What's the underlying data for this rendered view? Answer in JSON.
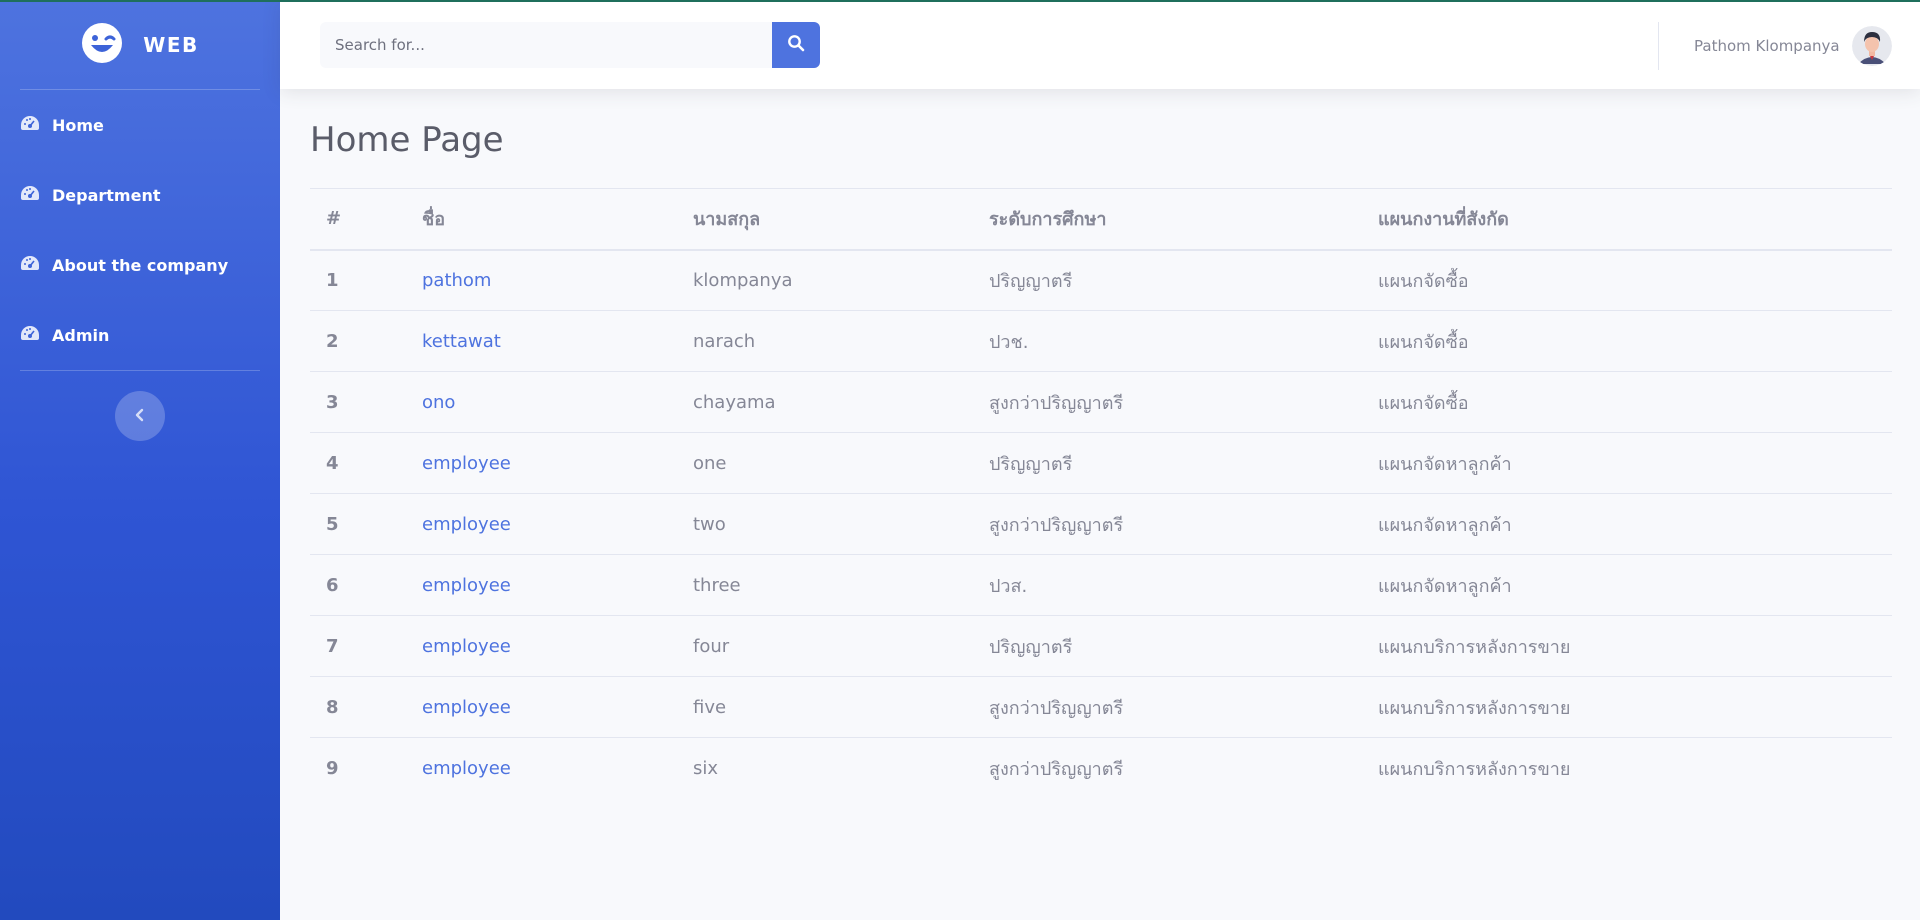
{
  "brand": {
    "name": "WEB",
    "icon": "laugh-wink-icon"
  },
  "sidebar": {
    "items": [
      {
        "label": "Home",
        "icon": "tachometer-icon"
      },
      {
        "label": "Department",
        "icon": "tachometer-icon"
      },
      {
        "label": "About the company",
        "icon": "tachometer-icon"
      },
      {
        "label": "Admin",
        "icon": "tachometer-icon"
      }
    ],
    "toggle_icon": "chevron-left-icon"
  },
  "topbar": {
    "search_placeholder": "Search for...",
    "search_icon": "search-icon",
    "user_name": "Pathom Klompanya"
  },
  "main": {
    "title": "Home Page",
    "table": {
      "headers": [
        "#",
        "ชื่อ",
        "นามสกุล",
        "ระดับการศึกษา",
        "แผนกงานที่สังกัด"
      ],
      "rows": [
        {
          "id": "1",
          "first": "pathom",
          "last": "klompanya",
          "education": "ปริญญาตรี",
          "dept": "แผนกจัดซื้อ"
        },
        {
          "id": "2",
          "first": "kettawat",
          "last": "narach",
          "education": "ปวช.",
          "dept": "แผนกจัดซื้อ"
        },
        {
          "id": "3",
          "first": "ono",
          "last": "chayama",
          "education": "สูงกว่าปริญญาตรี",
          "dept": "แผนกจัดซื้อ"
        },
        {
          "id": "4",
          "first": "employee",
          "last": "one",
          "education": "ปริญญาตรี",
          "dept": "แผนกจัดหาลูกค้า"
        },
        {
          "id": "5",
          "first": "employee",
          "last": "two",
          "education": "สูงกว่าปริญญาตรี",
          "dept": "แผนกจัดหาลูกค้า"
        },
        {
          "id": "6",
          "first": "employee",
          "last": "three",
          "education": "ปวส.",
          "dept": "แผนกจัดหาลูกค้า"
        },
        {
          "id": "7",
          "first": "employee",
          "last": "four",
          "education": "ปริญญาตรี",
          "dept": "แผนกบริการหลังการขาย"
        },
        {
          "id": "8",
          "first": "employee",
          "last": "five",
          "education": "สูงกว่าปริญญาตรี",
          "dept": "แผนกบริการหลังการขาย"
        },
        {
          "id": "9",
          "first": "employee",
          "last": "six",
          "education": "สูงกว่าปริญญาตรี",
          "dept": "แผนกบริการหลังการขาย"
        }
      ]
    }
  },
  "colors": {
    "primary": "#4e73df",
    "text_muted": "#858796",
    "heading": "#5a5c69",
    "background": "#f8f9fc"
  }
}
